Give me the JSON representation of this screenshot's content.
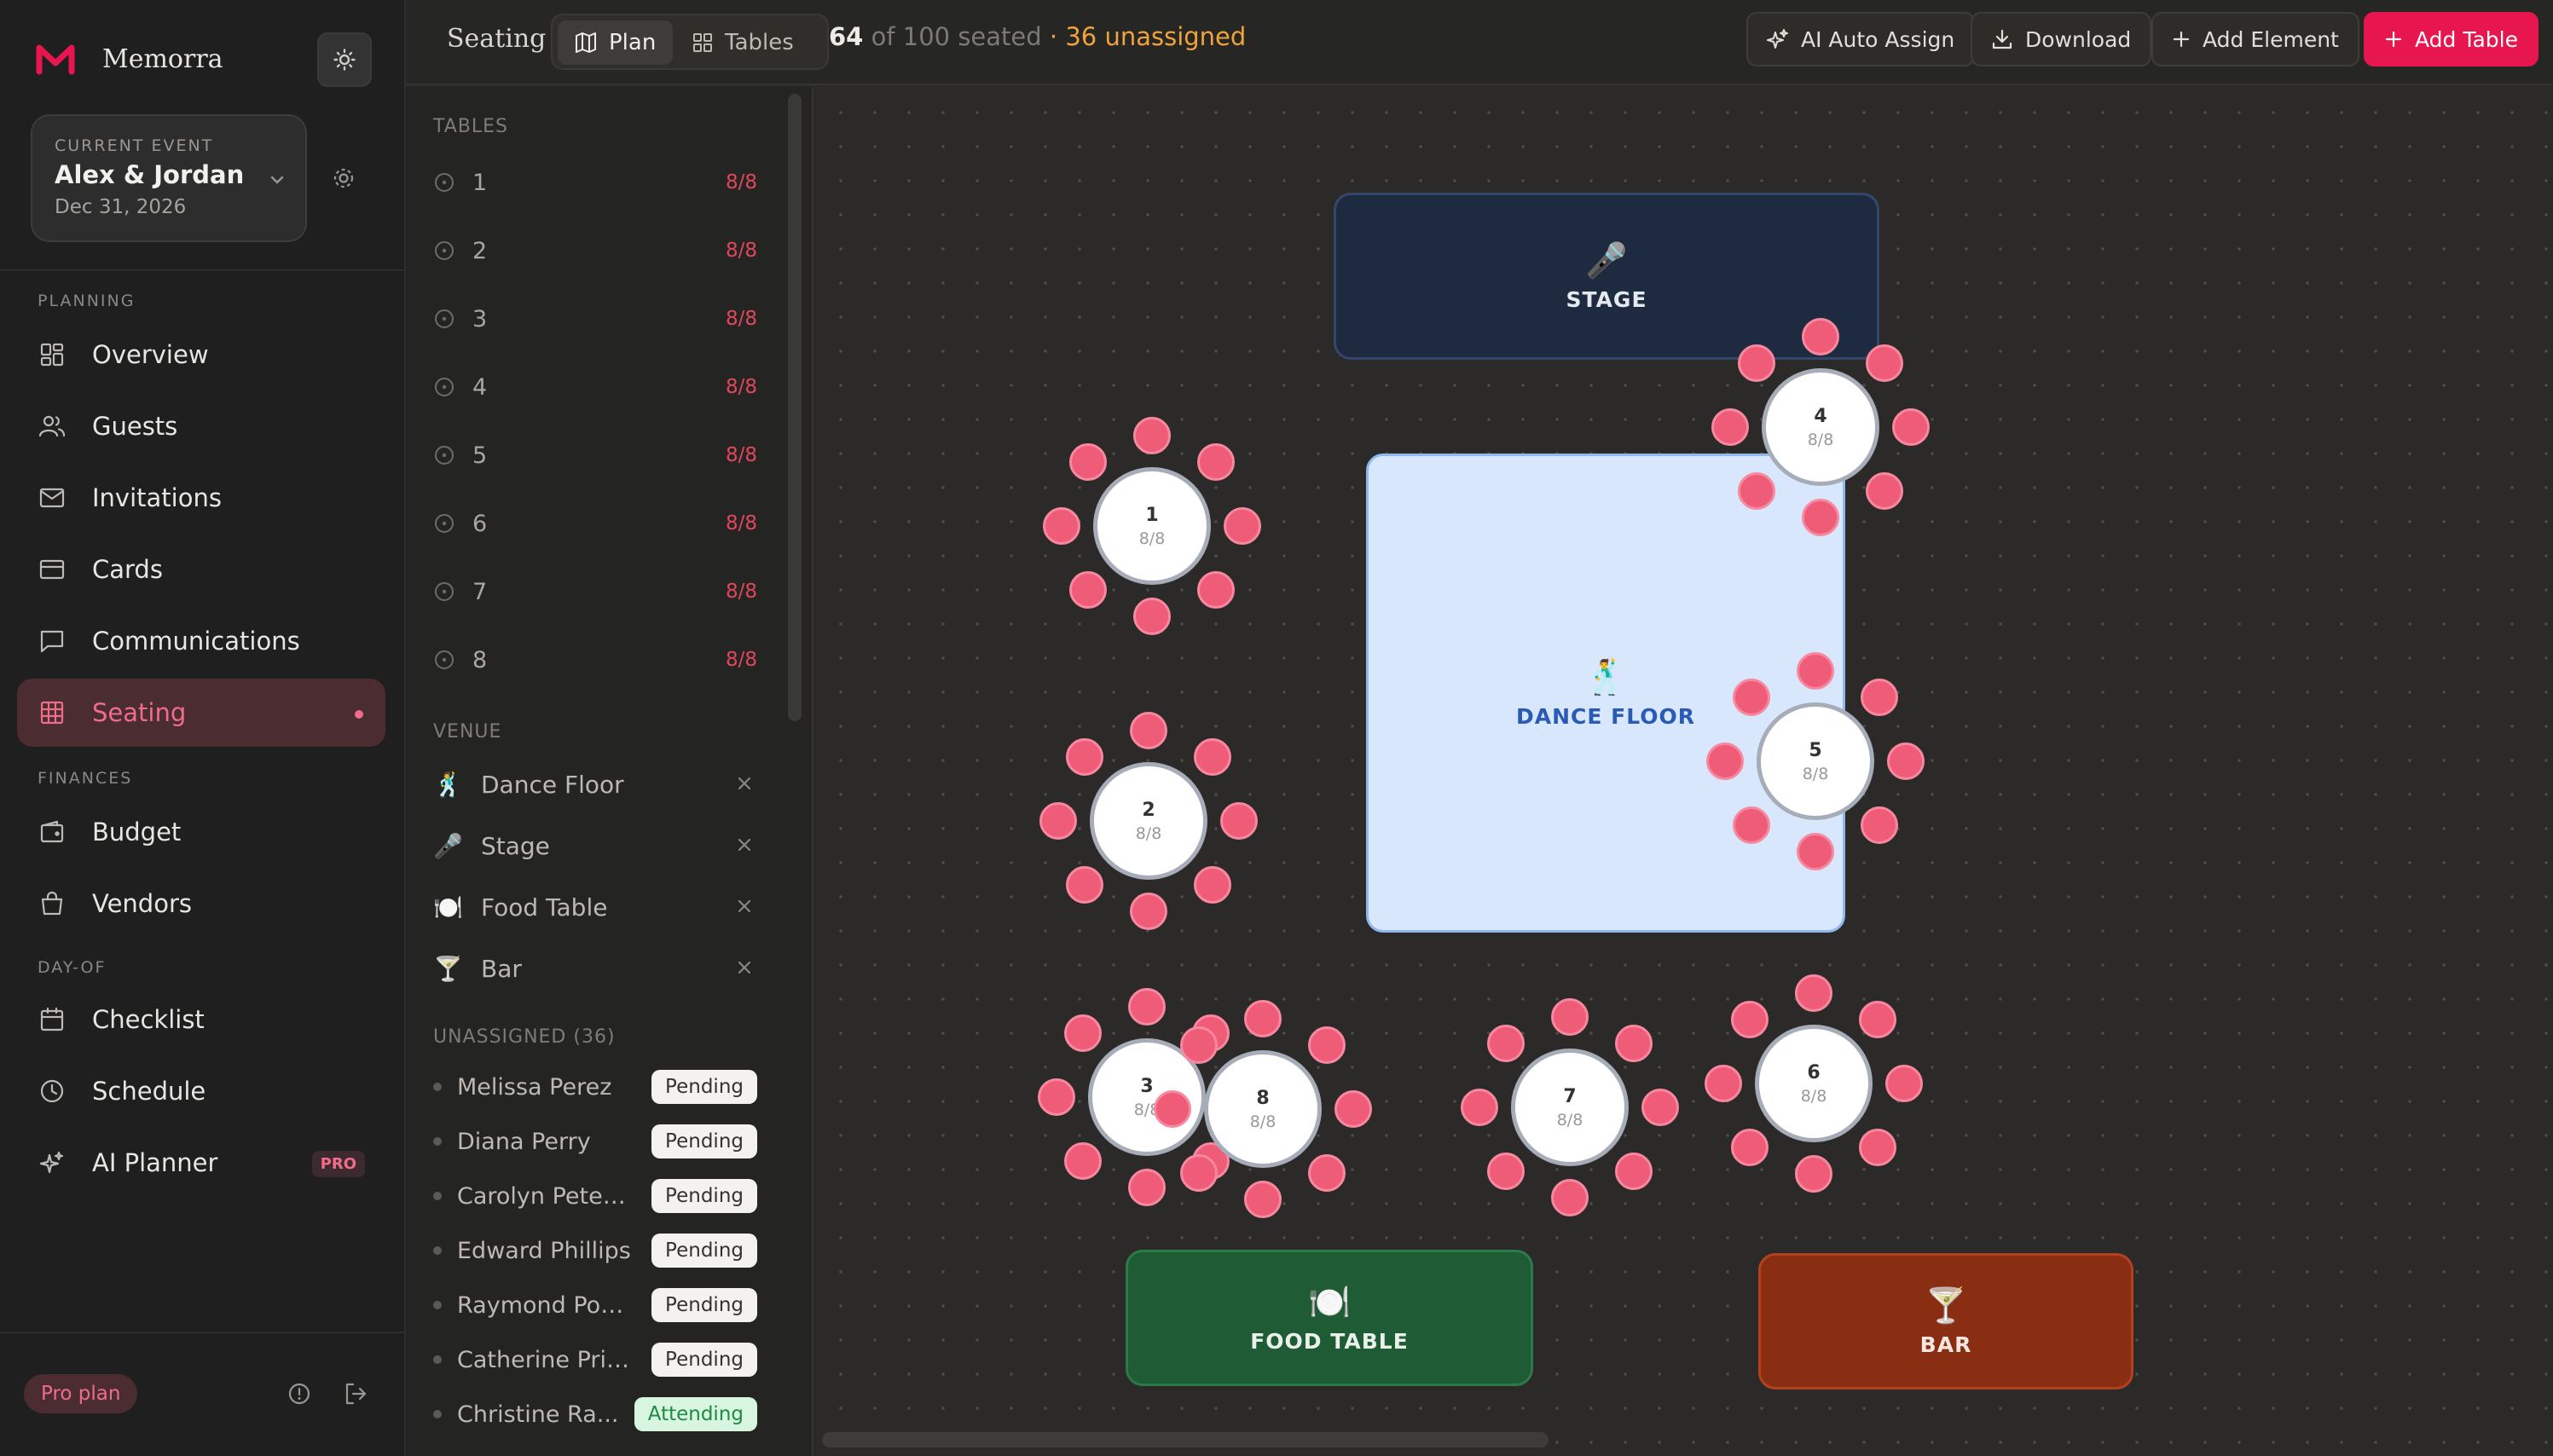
{
  "app": {
    "name": "Memorra"
  },
  "event": {
    "label": "CURRENT EVENT",
    "name": "Alex & Jordan",
    "date": "Dec 31, 2026"
  },
  "sidebar": {
    "sections": [
      {
        "label": "PLANNING",
        "items": [
          {
            "label": "Overview",
            "icon": "overview-icon"
          },
          {
            "label": "Guests",
            "icon": "guests-icon"
          },
          {
            "label": "Invitations",
            "icon": "mail-icon"
          },
          {
            "label": "Cards",
            "icon": "card-icon"
          },
          {
            "label": "Communications",
            "icon": "chat-icon"
          },
          {
            "label": "Seating",
            "icon": "grid-icon",
            "active": true
          }
        ]
      },
      {
        "label": "FINANCES",
        "items": [
          {
            "label": "Budget",
            "icon": "wallet-icon"
          },
          {
            "label": "Vendors",
            "icon": "shop-icon"
          }
        ]
      },
      {
        "label": "DAY-OF",
        "items": [
          {
            "label": "Checklist",
            "icon": "calendar-icon"
          },
          {
            "label": "Schedule",
            "icon": "clock-icon"
          },
          {
            "label": "AI Planner",
            "icon": "sparkle-icon",
            "badge": "PRO"
          }
        ]
      }
    ],
    "plan": "Pro plan"
  },
  "topbar": {
    "title": "Seating",
    "views": [
      "Plan",
      "Tables"
    ],
    "active_view": "Plan",
    "seated_count": "64",
    "seated_total": "of 100 seated",
    "unassigned": "· 36 unassigned",
    "buttons": {
      "auto_assign": "AI Auto Assign",
      "download": "Download",
      "add_element": "Add Element",
      "add_table": "Add Table"
    }
  },
  "panel": {
    "tables_label": "TABLES",
    "tables": [
      {
        "name": "1",
        "cap": "8/8"
      },
      {
        "name": "2",
        "cap": "8/8"
      },
      {
        "name": "3",
        "cap": "8/8"
      },
      {
        "name": "4",
        "cap": "8/8"
      },
      {
        "name": "5",
        "cap": "8/8"
      },
      {
        "name": "6",
        "cap": "8/8"
      },
      {
        "name": "7",
        "cap": "8/8"
      },
      {
        "name": "8",
        "cap": "8/8"
      }
    ],
    "venue_label": "VENUE",
    "venue": [
      {
        "icon": "🕺",
        "name": "Dance Floor"
      },
      {
        "icon": "🎤",
        "name": "Stage"
      },
      {
        "icon": "🍽️",
        "name": "Food Table"
      },
      {
        "icon": "🍸",
        "name": "Bar"
      }
    ],
    "unassigned_label": "UNASSIGNED (36)",
    "unassigned": [
      {
        "name": "Melissa Perez",
        "status": "Pending"
      },
      {
        "name": "Diana Perry",
        "status": "Pending"
      },
      {
        "name": "Carolyn Peters...",
        "status": "Pending"
      },
      {
        "name": "Edward Phillips",
        "status": "Pending"
      },
      {
        "name": "Raymond Pow...",
        "status": "Pending"
      },
      {
        "name": "Catherine Price",
        "status": "Pending"
      },
      {
        "name": "Christine Ra...",
        "status": "Attending"
      }
    ]
  },
  "canvas": {
    "stage": {
      "icon": "🎤",
      "label": "STAGE"
    },
    "dance_floor": {
      "icon": "🕺",
      "label": "DANCE FLOOR"
    },
    "food_table": {
      "icon": "🍽️",
      "label": "FOOD TABLE"
    },
    "bar": {
      "icon": "🍸",
      "label": "BAR"
    },
    "tables": [
      {
        "num": "1",
        "cap": "8/8"
      },
      {
        "num": "2",
        "cap": "8/8"
      },
      {
        "num": "3",
        "cap": "8/8"
      },
      {
        "num": "4",
        "cap": "8/8"
      },
      {
        "num": "5",
        "cap": "8/8"
      },
      {
        "num": "6",
        "cap": "8/8"
      },
      {
        "num": "7",
        "cap": "8/8"
      },
      {
        "num": "8",
        "cap": "8/8"
      }
    ]
  },
  "colors": {
    "accent": "#e8164f",
    "seat": "#ee5c78",
    "capacity_full": "#e0475d",
    "unassigned": "#f0a23b"
  }
}
